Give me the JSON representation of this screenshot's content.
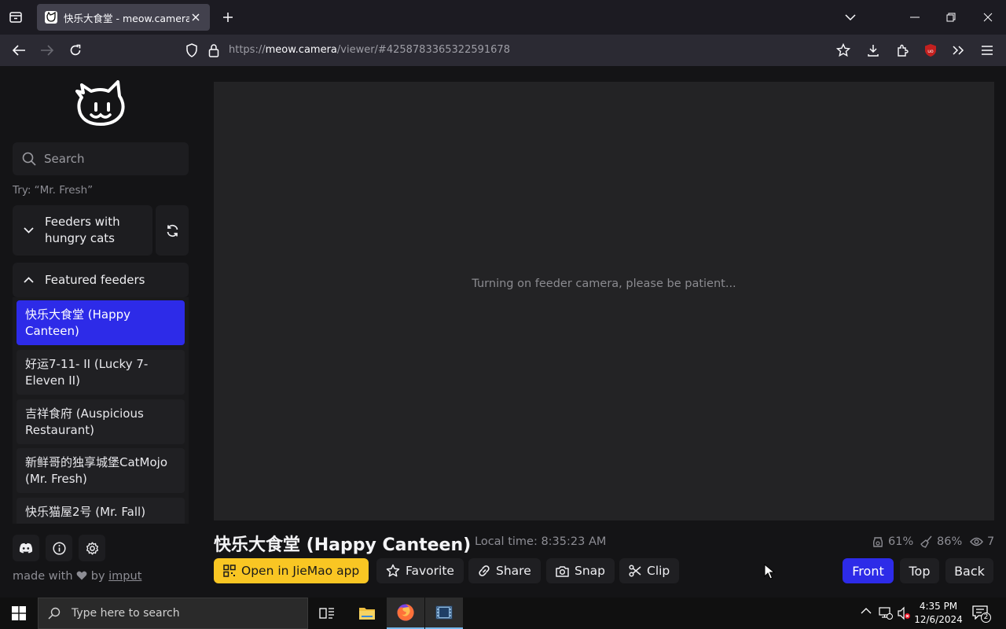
{
  "browser": {
    "tab_title": "快乐大食堂 - meow.camera",
    "url_prefix": "https://",
    "url_host": "meow.camera",
    "url_path": "/viewer/#4258783365322591678"
  },
  "sidebar": {
    "search_placeholder": "Search",
    "try_hint": "Try: “Mr. Fresh”",
    "hungry_label": "Feeders with hungry cats",
    "featured_label": "Featured feeders",
    "feeders": [
      {
        "label": "快乐大食堂 (Happy Canteen)"
      },
      {
        "label": "好运7-11- II (Lucky 7-Eleven II)"
      },
      {
        "label": "吉祥食府 (Auspicious Restaurant)"
      },
      {
        "label": "新鲜哥的独享城堡CatMojo (Mr. Fresh)"
      },
      {
        "label": "快乐猫屋2号 (Mr. Fall)"
      }
    ],
    "made_with_prefix": "made with",
    "made_with_by": "by",
    "made_with_author": "imput"
  },
  "viewer": {
    "loading_message": "Turning on feeder camera, please be patient...",
    "feeder_title": "快乐大食堂 (Happy Canteen)",
    "local_time": "Local time: 8:35:23 AM",
    "food_level": "61%",
    "cleanliness": "86%",
    "viewers": "7"
  },
  "actions": {
    "open_app": "Open in JieMao app",
    "favorite": "Favorite",
    "share": "Share",
    "snap": "Snap",
    "clip": "Clip"
  },
  "views": {
    "front": "Front",
    "top": "Top",
    "back": "Back",
    "active": "Front"
  },
  "taskbar": {
    "search_placeholder": "Type here to search",
    "time": "4:35 PM",
    "date": "12/6/2024",
    "notifications": "2"
  },
  "colors": {
    "accent": "#2d2be8",
    "app_button": "#f9c623"
  }
}
